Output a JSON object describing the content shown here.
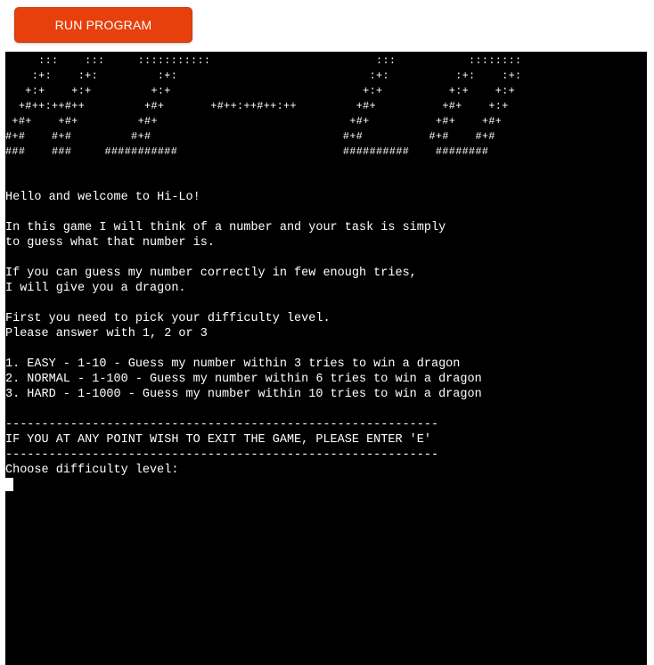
{
  "toolbar": {
    "run_label": "RUN PROGRAM"
  },
  "colors": {
    "accent": "#e8400c",
    "terminal_bg": "#000000",
    "terminal_fg": "#ffffff"
  },
  "terminal": {
    "banner": [
      "     :::    :::     :::::::::::                         :::           ::::::::",
      "    :+:    :+:         :+:                             :+:          :+:    :+:",
      "   +:+    +:+         +:+                             +:+          +:+    +:+",
      "  +#++:++#++         +#+       +#++:++#++:++         +#+          +#+    +:+",
      " +#+    +#+         +#+                             +#+          +#+    +#+",
      "#+#    #+#         #+#                             #+#          #+#    #+#",
      "###    ###     ###########                         ##########    ########"
    ],
    "body_text": "\n\nHello and welcome to Hi-Lo!\n\nIn this game I will think of a number and your task is simply\nto guess what that number is.\n\nIf you can guess my number correctly in few enough tries,\nI will give you a dragon.\n\nFirst you need to pick your difficulty level.\nPlease answer with 1, 2 or 3\n\n1. EASY - 1-10 - Guess my number within 3 tries to win a dragon\n2. NORMAL - 1-100 - Guess my number within 6 tries to win a dragon\n3. HARD - 1-1000 - Guess my number within 10 tries to win a dragon\n\n------------------------------------------------------------\nIF YOU AT ANY POINT WISH TO EXIT THE GAME, PLEASE ENTER 'E'\n------------------------------------------------------------\nChoose difficulty level:",
    "input_value": ""
  }
}
